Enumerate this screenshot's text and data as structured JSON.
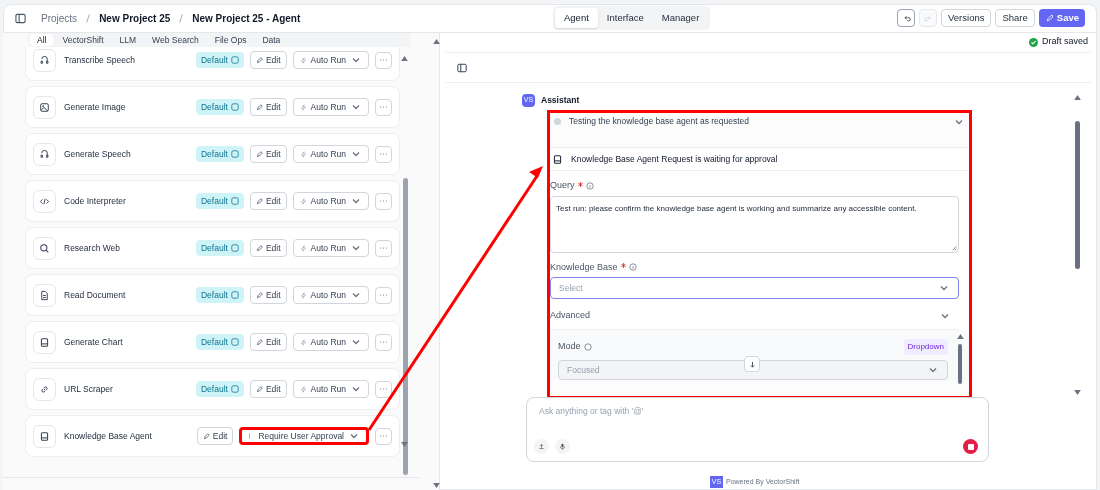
{
  "breadcrumb": [
    "Projects",
    "New Project 25",
    "New Project 25 - Agent"
  ],
  "view_tabs": [
    {
      "label": "Agent",
      "selected": true
    },
    {
      "label": "Interface",
      "selected": false
    },
    {
      "label": "Manager",
      "selected": false
    }
  ],
  "history": [
    {
      "kind": "undo",
      "disabled": false
    },
    {
      "kind": "redo",
      "disabled": true
    }
  ],
  "actions": [
    {
      "label": "Versions",
      "kind": "versions"
    },
    {
      "label": "Share",
      "kind": "share"
    },
    {
      "label": "Save",
      "kind": "save"
    }
  ],
  "filter_tabs": [
    {
      "label": "All",
      "selected": true
    },
    {
      "label": "VectorShift",
      "selected": false
    },
    {
      "label": "LLM",
      "selected": false
    },
    {
      "label": "Web Search",
      "selected": false
    },
    {
      "label": "File Ops",
      "selected": false
    },
    {
      "label": "Data",
      "selected": false
    }
  ],
  "tools": [
    {
      "name": "Transcribe Speech",
      "kind": "speech",
      "badge": "Default",
      "edit": "Edit",
      "mode": "Auto Run",
      "highlighted": false
    },
    {
      "name": "Generate Image",
      "kind": "image",
      "badge": "Default",
      "edit": "Edit",
      "mode": "Auto Run",
      "highlighted": false
    },
    {
      "name": "Generate Speech",
      "kind": "speech",
      "badge": "Default",
      "edit": "Edit",
      "mode": "Auto Run",
      "highlighted": false
    },
    {
      "name": "Code Interpreter",
      "kind": "code",
      "badge": "Default",
      "edit": "Edit",
      "mode": "Auto Run",
      "highlighted": false
    },
    {
      "name": "Research Web",
      "kind": "search",
      "badge": "Default",
      "edit": "Edit",
      "mode": "Auto Run",
      "highlighted": false
    },
    {
      "name": "Read Document",
      "kind": "document",
      "badge": "Default",
      "edit": "Edit",
      "mode": "Auto Run",
      "highlighted": false
    },
    {
      "name": "Generate Chart",
      "kind": "book",
      "badge": "Default",
      "edit": "Edit",
      "mode": "Auto Run",
      "highlighted": false
    },
    {
      "name": "URL Scraper",
      "kind": "link",
      "badge": "Default",
      "edit": "Edit",
      "mode": "Auto Run",
      "highlighted": false
    },
    {
      "name": "Knowledge Base Agent",
      "kind": "book",
      "edit": "Edit",
      "mode": "Require User Approval",
      "highlighted": true
    }
  ],
  "save_status": "Draft saved",
  "chat": {
    "avatar": "VS",
    "sender": "Assistant",
    "step": {
      "text": "Testing the knowledge base agent as requested",
      "expanded": false
    },
    "approval": {
      "highlighted": true,
      "title": "Knowledge Base Agent Request is waiting for approval",
      "fields": [
        {
          "kind": "textarea",
          "label": "Query",
          "required": true,
          "value": "Test run: please confirm the knowledge base agent is working and summarize any accessible content."
        },
        {
          "kind": "select",
          "label": "Knowledge Base",
          "required": true,
          "placeholder": "Select",
          "focused": true
        }
      ],
      "advanced": {
        "label": "Advanced",
        "expanded": true,
        "fields": [
          {
            "label": "Mode",
            "type_badge": "Dropdown",
            "value": "Focused"
          }
        ]
      }
    }
  },
  "input": {
    "placeholder": "Ask anything or tag with '@'"
  },
  "footer": {
    "logo": "VS",
    "text": "Powered By VectorShift"
  }
}
